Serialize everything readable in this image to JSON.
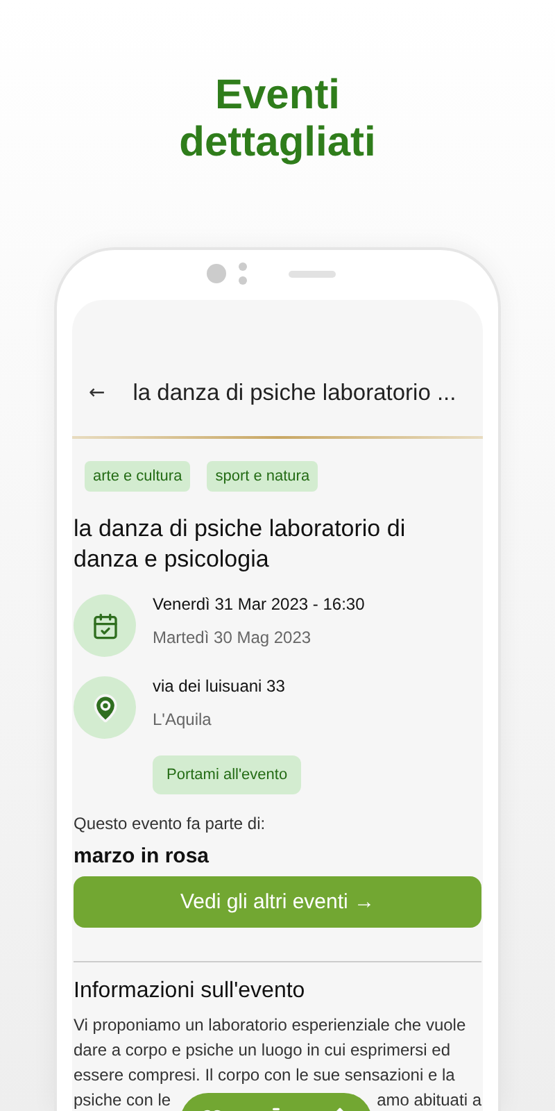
{
  "headline": [
    "Eventi",
    "dettagliati"
  ],
  "header": {
    "back": "←",
    "title": "la danza di psiche laboratorio ..."
  },
  "tags": [
    "arte e cultura",
    "sport e natura"
  ],
  "event_title": "la danza di psiche laboratorio di danza e psicologia",
  "details": [
    {
      "kind": "date",
      "primary": "Venerdì 31 Mar 2023 - 16:30",
      "secondary": "Martedì 30 Mag 2023"
    },
    {
      "kind": "place",
      "primary": "via dei luisuani 33",
      "secondary": "L'Aquila"
    }
  ],
  "directions_button": "Portami all'evento",
  "series": {
    "label": "Questo evento fa parte di:",
    "name": "marzo in rosa",
    "button": "Vedi gli altri eventi →"
  },
  "info": {
    "heading": "Informazioni sull'evento",
    "text": "Vi proponiamo un laboratorio esperienziale che vuole dare a corpo e psiche un luogo in cui esprimersi ed essere compresi. Il corpo con le sue sensazioni e la",
    "cut_left": "psiche con le",
    "cut_right": "amo abituati a"
  }
}
